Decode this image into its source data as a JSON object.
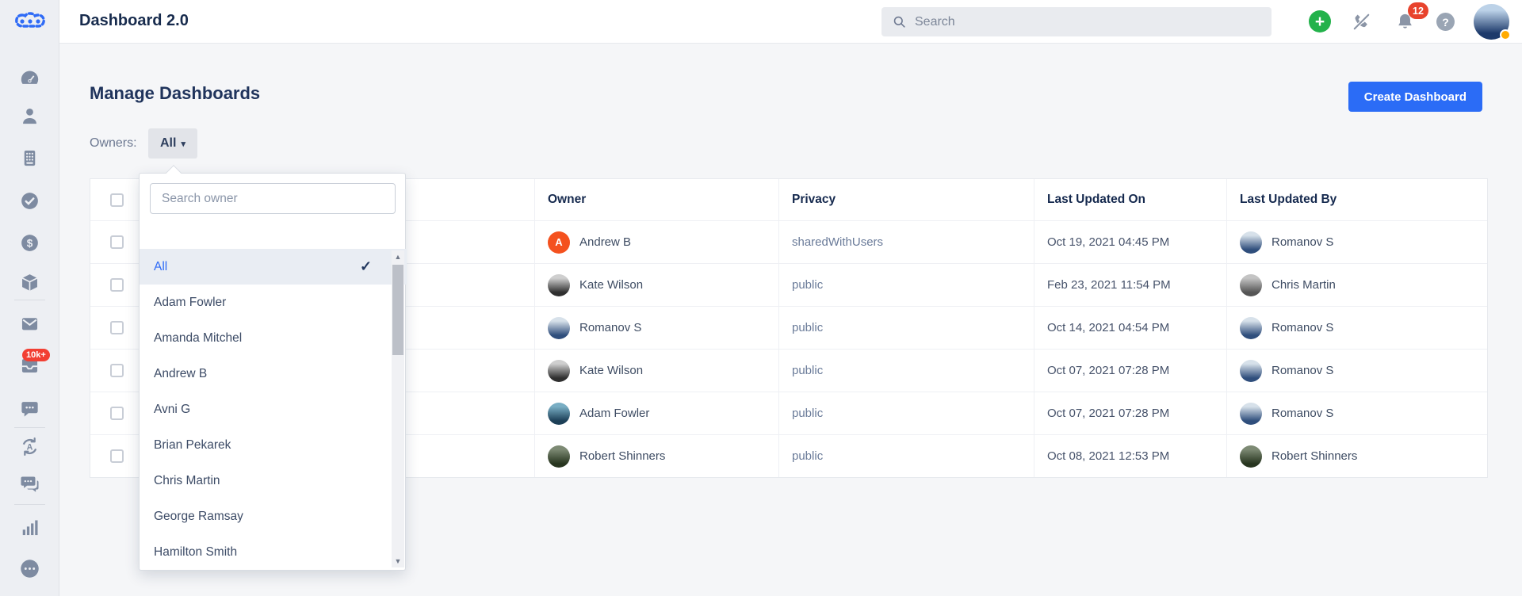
{
  "app": {
    "title": "Dashboard 2.0"
  },
  "header": {
    "search_placeholder": "Search",
    "notification_count": "12",
    "icons": [
      "add-icon",
      "phone-muted-icon",
      "bell-icon",
      "help-icon"
    ],
    "help_glyph": "?",
    "plus_glyph": "+",
    "avatar": {
      "kind": "photo",
      "colors": [
        "#bcd2e8",
        "#1d3a6b"
      ]
    },
    "status_dot_color": "#ffab00"
  },
  "sidebar": {
    "items": [
      {
        "icon": "gauge-icon"
      },
      {
        "icon": "user-icon"
      },
      {
        "icon": "calculator-icon"
      },
      {
        "icon": "check-circle-icon"
      },
      {
        "icon": "dollar-icon"
      },
      {
        "icon": "cube-icon"
      },
      {
        "icon": "mail-icon"
      },
      {
        "icon": "inbox-icon",
        "badge": "10k+"
      },
      {
        "icon": "chat-bubble-icon"
      },
      {
        "icon": "translate-loop-icon"
      },
      {
        "icon": "chat-multi-icon"
      },
      {
        "icon": "bar-chart-icon"
      },
      {
        "icon": "more-ellipsis-icon"
      }
    ],
    "inbox_badge": "10k+"
  },
  "page": {
    "heading": "Manage Dashboards",
    "create_button_label": "Create Dashboard",
    "owners_label": "Owners:",
    "owner_filter_value": "All",
    "owner_filter_caret": "▾"
  },
  "owner_dropdown": {
    "search_placeholder": "Search owner",
    "selected_tick": "✓",
    "scroll_up_glyph": "▲",
    "scroll_down_glyph": "▼",
    "items": [
      {
        "label": "All",
        "selected": true
      },
      {
        "label": "Adam Fowler",
        "selected": false
      },
      {
        "label": "Amanda Mitchel",
        "selected": false
      },
      {
        "label": "Andrew B",
        "selected": false
      },
      {
        "label": "Avni G",
        "selected": false
      },
      {
        "label": "Brian Pekarek",
        "selected": false
      },
      {
        "label": "Chris Martin",
        "selected": false
      },
      {
        "label": "George Ramsay",
        "selected": false
      },
      {
        "label": "Hamilton Smith",
        "selected": false
      }
    ]
  },
  "table": {
    "columns": [
      "Owner",
      "Privacy",
      "Last Updated On",
      "Last Updated By"
    ],
    "rows": [
      {
        "owner": "Andrew B",
        "owner_avatar": {
          "kind": "letter",
          "letter": "A",
          "colors": [
            "#f4511e"
          ]
        },
        "privacy": "sharedWithUsers",
        "updated_on": "Oct 19, 2021 04:45 PM",
        "updated_by": "Romanov S",
        "updated_by_avatar": {
          "kind": "photo",
          "colors": [
            "#d7e1ea",
            "#2f4e7c"
          ]
        }
      },
      {
        "owner": "Kate Wilson",
        "owner_avatar": {
          "kind": "photo",
          "colors": [
            "#cfcfcf",
            "#2f2f2f"
          ]
        },
        "privacy": "public",
        "updated_on": "Feb 23, 2021 11:54 PM",
        "updated_by": "Chris Martin",
        "updated_by_avatar": {
          "kind": "photo",
          "colors": [
            "#c4c4c4",
            "#555555"
          ]
        }
      },
      {
        "owner": "Romanov S",
        "owner_avatar": {
          "kind": "photo",
          "colors": [
            "#d7e1ea",
            "#2f4e7c"
          ]
        },
        "privacy": "public",
        "updated_on": "Oct 14, 2021 04:54 PM",
        "updated_by": "Romanov S",
        "updated_by_avatar": {
          "kind": "photo",
          "colors": [
            "#d7e1ea",
            "#2f4e7c"
          ]
        }
      },
      {
        "owner": "Kate Wilson",
        "owner_avatar": {
          "kind": "photo",
          "colors": [
            "#cfcfcf",
            "#2f2f2f"
          ]
        },
        "privacy": "public",
        "updated_on": "Oct 07, 2021 07:28 PM",
        "updated_by": "Romanov S",
        "updated_by_avatar": {
          "kind": "photo",
          "colors": [
            "#d7e1ea",
            "#2f4e7c"
          ]
        }
      },
      {
        "owner": "Adam Fowler",
        "owner_avatar": {
          "kind": "photo",
          "colors": [
            "#79aec4",
            "#1c3f57"
          ]
        },
        "privacy": "public",
        "updated_on": "Oct 07, 2021 07:28 PM",
        "updated_by": "Romanov S",
        "updated_by_avatar": {
          "kind": "photo",
          "colors": [
            "#d7e1ea",
            "#2f4e7c"
          ]
        }
      },
      {
        "owner": "Robert Shinners",
        "owner_avatar": {
          "kind": "photo",
          "colors": [
            "#7d8a74",
            "#27351f"
          ]
        },
        "privacy": "public",
        "updated_on": "Oct 08, 2021 12:53 PM",
        "updated_by": "Robert Shinners",
        "updated_by_avatar": {
          "kind": "photo",
          "colors": [
            "#7d8a74",
            "#27351f"
          ]
        }
      }
    ]
  },
  "colors": {
    "accent_blue": "#2f6bf6",
    "create_button_blue": "#2b6cf6",
    "notification_red": "#e8432d",
    "sidebar_badge_red": "#f23f33",
    "status_dot_orange": "#ffab00",
    "avatar_orange": "#f4511e"
  }
}
